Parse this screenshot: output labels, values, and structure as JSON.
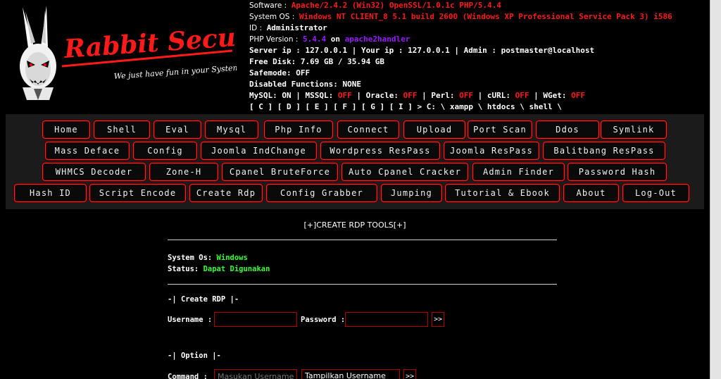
{
  "header": {
    "logo_text": "Rabbit Security",
    "logo_tagline": "We just have fun in your System!",
    "software": {
      "label": "Software :",
      "value": "Apache/2.4.2 (Win32) OpenSSL/1.0.1c PHP/5.4.4"
    },
    "system_os": {
      "label": "System OS :",
      "value": "Windows NT CLIENT_8 5.1 build 2600 (Windows XP Professional Service Pack 3) i586"
    },
    "id": {
      "label": "ID :",
      "value": "Administrator"
    },
    "php_version": {
      "label": "PHP Version :",
      "value": "5.4.4",
      "on": "on",
      "handler": "apache2handler"
    },
    "server_line": "Server ip : 127.0.0.1 | Your ip : 127.0.0.1 | Admin : postmaster@localhost",
    "free_disk": "Free Disk: 7.69 GB / 35.94 GB",
    "safemode": "Safemode: OFF",
    "disabled_functions": "Disabled Functions: NONE",
    "services": [
      {
        "name": "MySQL:",
        "state": "ON",
        "sep": "|"
      },
      {
        "name": "MSSQL:",
        "state": "OFF",
        "sep": "|"
      },
      {
        "name": "Oracle:",
        "state": "OFF",
        "sep": "|"
      },
      {
        "name": "Perl:",
        "state": "OFF",
        "sep": "|"
      },
      {
        "name": "cURL:",
        "state": "OFF",
        "sep": "|"
      },
      {
        "name": "WGet:",
        "state": "OFF",
        "sep": ""
      }
    ],
    "drives": [
      "[ C ]",
      "[ D ]",
      "[ E ]",
      "[ F ]",
      "[ G ]",
      "[ I ]"
    ],
    "path": {
      "prefix": ">",
      "parts": [
        "C:",
        "\\",
        "xampp",
        "\\",
        "htdocs",
        "\\",
        "shell",
        "\\"
      ]
    }
  },
  "nav": {
    "row1": [
      "Home",
      "Shell",
      "Eval",
      "Mysql",
      "Php Info",
      "Connect",
      "Upload",
      "Port Scan",
      "Ddos",
      "Symlink"
    ],
    "row2": [
      "Mass Deface",
      "Config",
      "Joomla IndChange",
      "Wordpress ResPass",
      "Joomla ResPass",
      "Balitbang ResPass"
    ],
    "row3": [
      "WHMCS Decoder",
      "Zone-H",
      "Cpanel BruteForce",
      "Auto Cpanel Cracker",
      "Admin Finder",
      "Password Hash"
    ],
    "row4": [
      "Hash ID",
      "Script Encode",
      "Create Rdp",
      "Config Grabber",
      "Jumping",
      "Tutorial & Ebook",
      "About",
      "Log-Out"
    ]
  },
  "rdp": {
    "title": "[+]CREATE RDP TOOLS[+]",
    "system_os_label": "System Os:",
    "system_os_value": "Windows",
    "status_label": "Status:",
    "status_value": "Dapat Digunakan",
    "create_heading": "-| Create RDP |-",
    "username_label": "Username :",
    "password_label": "Password :",
    "go_label": ">>",
    "option_heading": "-| Option |-",
    "command_label": "Command :",
    "command_placeholder": "Masukan Username",
    "command_select": "Tampilkan Username"
  },
  "colors": {
    "accent_red": "#ff1a1a",
    "green": "#33ff33",
    "purple": "#9a1aff"
  }
}
